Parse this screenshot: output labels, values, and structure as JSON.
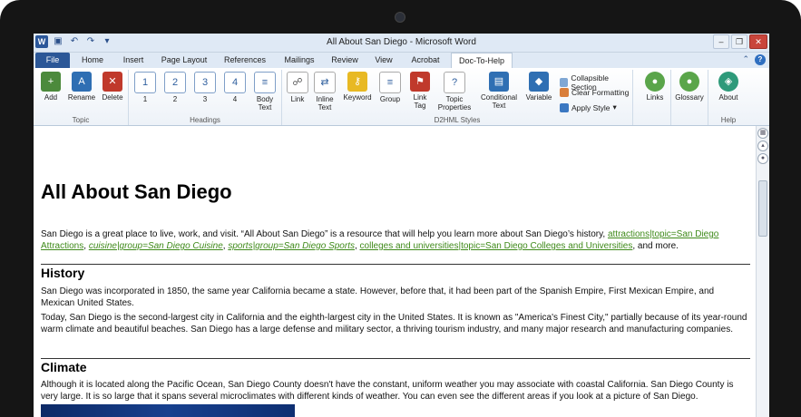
{
  "window": {
    "title": "All About San Diego - Microsoft Word",
    "qat_logo": "W"
  },
  "tabs": [
    "File",
    "Home",
    "Insert",
    "Page Layout",
    "References",
    "Mailings",
    "Review",
    "View",
    "Acrobat",
    "Doc-To-Help"
  ],
  "ribbon": {
    "topic": {
      "label": "Topic",
      "buttons": [
        "Add",
        "Rename",
        "Delete"
      ]
    },
    "headings": {
      "label": "Headings",
      "buttons": [
        "1",
        "2",
        "3",
        "4",
        "Body Text"
      ]
    },
    "d2h": {
      "label": "D2HML Styles",
      "buttons": [
        "Link",
        "Inline Text",
        "Keyword",
        "Group",
        "Link Tag",
        "Topic Properties",
        "Conditional Text",
        "Variable"
      ],
      "small": [
        "Collapsible Section",
        "Clear Formatting",
        "Apply Style"
      ]
    },
    "links": {
      "button": "Links"
    },
    "glossary": {
      "button": "Glossary"
    },
    "help": {
      "label": "Help",
      "button": "About"
    }
  },
  "document": {
    "title": "All About San Diego",
    "intro": {
      "text1": "San Diego is a great place to live, work, and visit. “All About San Diego” is a resource that will help you learn more about San Diego’s history, ",
      "link1": "attractions|topic=San Diego Attractions",
      "sep1": ", ",
      "link2": "cuisine|group=San Diego Cuisine",
      "sep2": ", ",
      "link3": "sports|group=San Diego Sports",
      "sep3": ", ",
      "link4": "colleges and universities|topic=San Diego Colleges and Universities",
      "end": ", and more."
    },
    "history_heading": "History",
    "history_p1": "San Diego was incorporated in 1850, the same year California became a state. However, before that, it had been part of the Spanish Empire, First Mexican Empire, and Mexican United States.",
    "history_p2": "Today, San Diego is the second-largest city in California and the eighth-largest city in the United States. It is known as \"America's Finest City,\" partially because of its year-round warm climate and beautiful beaches. San Diego has a large defense and military sector, a thriving tourism industry, and many major research and manufacturing companies.",
    "climate_heading": "Climate",
    "climate_p1": "Although it is located along the Pacific Ocean, San Diego County doesn't have the constant, uniform weather you may associate with coastal California. San Diego County is very large. It is so large that it spans several microclimates with different kinds of weather. You can even see the different areas if you look at a picture of San Diego."
  }
}
